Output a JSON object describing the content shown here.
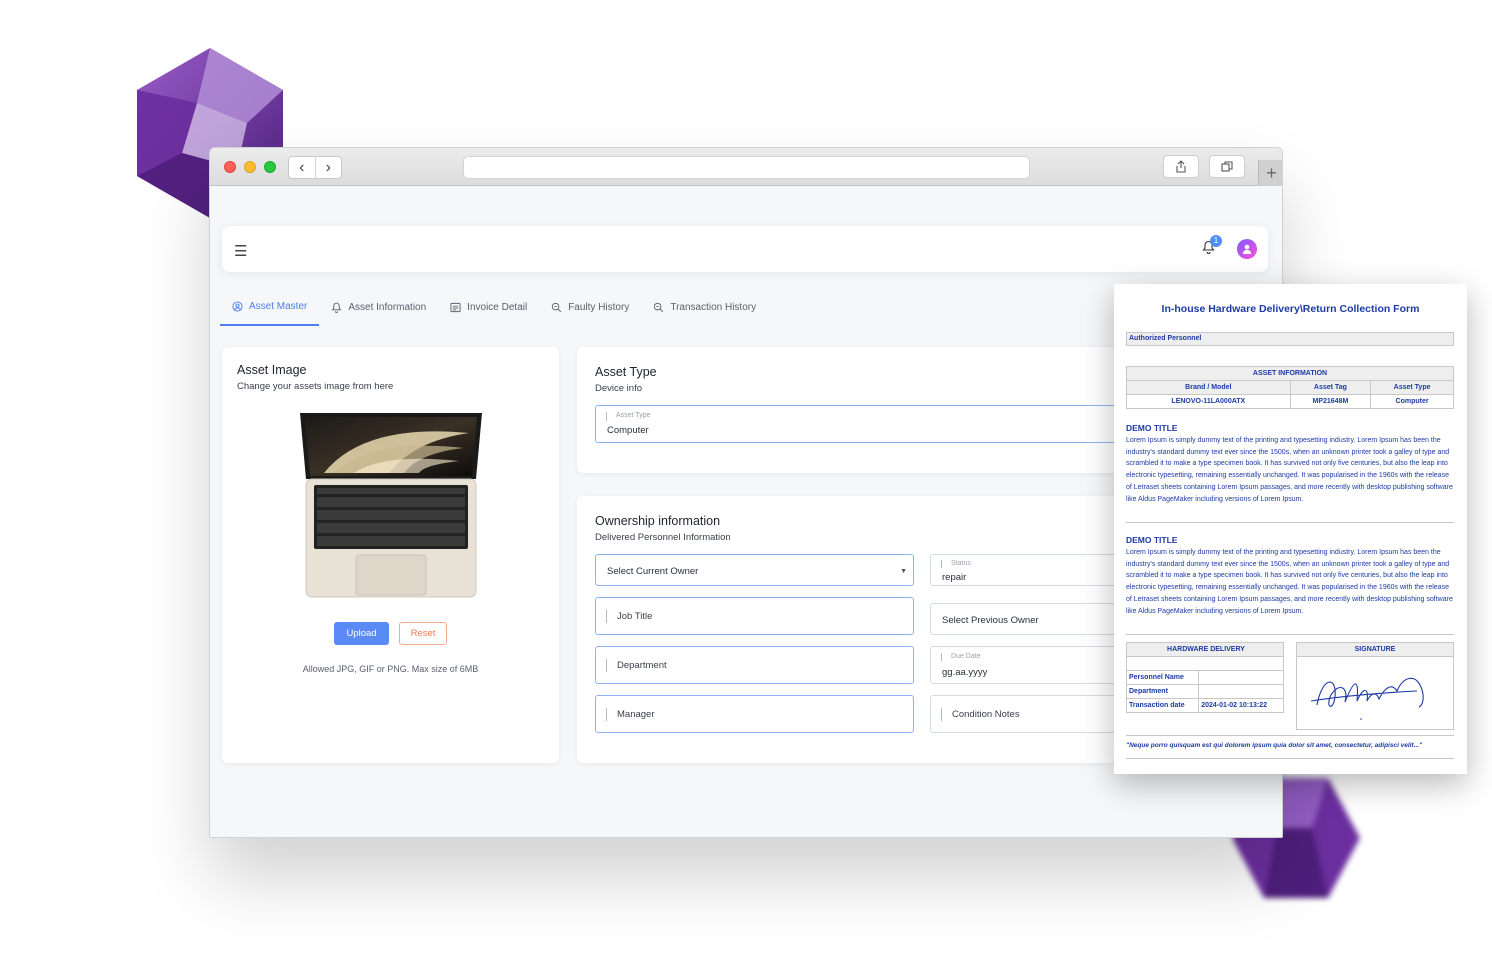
{
  "colors": {
    "accent": "#4f7ef0",
    "reset": "#f07a5a",
    "doc_text": "#1d3aa6",
    "gem": "#7a3fb0"
  },
  "header": {
    "notification_count": "1"
  },
  "tabs": [
    {
      "label": "Asset Master",
      "icon": "user-circle-icon",
      "active": true
    },
    {
      "label": "Asset Information",
      "icon": "bell-icon",
      "active": false
    },
    {
      "label": "Invoice Detail",
      "icon": "list-icon",
      "active": false
    },
    {
      "label": "Faulty History",
      "icon": "search-icon",
      "active": false
    },
    {
      "label": "Transaction History",
      "icon": "search-icon",
      "active": false
    }
  ],
  "asset_image": {
    "title": "Asset Image",
    "subtitle": "Change your assets image from here",
    "upload_label": "Upload",
    "reset_label": "Reset",
    "hint": "Allowed JPG, GIF or PNG. Max size of 6MB"
  },
  "asset_type": {
    "title": "Asset Type",
    "subtitle": "Device info",
    "field_label": "Asset Type",
    "field_value": "Computer"
  },
  "ownership": {
    "title": "Ownership information",
    "subtitle": "Delivered Personnel Information",
    "current_owner": "Select Current Owner",
    "status_label": "Status",
    "status_value": "repair",
    "job_title": "Job Title",
    "previous_owner": "Select Previous Owner",
    "department": "Department",
    "due_date_label": "Due Date",
    "due_date_value": "gg.aa.yyyy",
    "manager": "Manager",
    "condition_notes": "Condition Notes"
  },
  "document": {
    "title": "In-house Hardware Delivery\\Return Collection Form",
    "authorized": "Authorized Personnel",
    "asset_info_title": "ASSET INFORMATION",
    "columns": [
      "Brand / Model",
      "Asset Tag",
      "Asset Type"
    ],
    "row": [
      "LENOVO-11LA000ATX",
      "MP21648M",
      "Computer"
    ],
    "section1_title": "DEMO TITLE",
    "section1_text": "Lorem Ipsum is simply dummy text of the printing and typesetting industry. Lorem Ipsum has been the industry's standard dummy text ever since the 1500s, when an unknown printer took a galley of type and scrambled it to make a type specimen book. It has survived not only five centuries, but also the leap into electronic typesetting, remaining essentially unchanged. It was popularised in the 1960s with the release of Letraset sheets containing Lorem Ipsum passages, and more recently with desktop publishing software like Aldus PageMaker including versions of Lorem Ipsum.",
    "section2_title": "DEMO TITLE",
    "section2_text": "Lorem Ipsum is simply dummy text of the printing and typesetting industry. Lorem Ipsum has been the industry's standard dummy text ever since the 1500s, when an unknown printer took a galley of type and scrambled it to make a type specimen book. It has survived not only five centuries, but also the leap into electronic typesetting, remaining essentially unchanged. It was popularised in the 1960s with the release of Letraset sheets containing Lorem Ipsum passages, and more recently with desktop publishing software like Aldus PageMaker including versions of Lorem Ipsum.",
    "hardware_delivery_title": "HARDWARE DELIVERY",
    "personnel_name_label": "Personnel Name",
    "department_label": "Department",
    "transaction_date_label": "Transaction date",
    "transaction_date_value": "2024-01-02 10:13:22",
    "signature_title": "SIGNATURE",
    "quote": "\"Neque porro quisquam est qui dolorem ipsum quia dolor sit amet, consectetur, adipisci velit...\""
  }
}
